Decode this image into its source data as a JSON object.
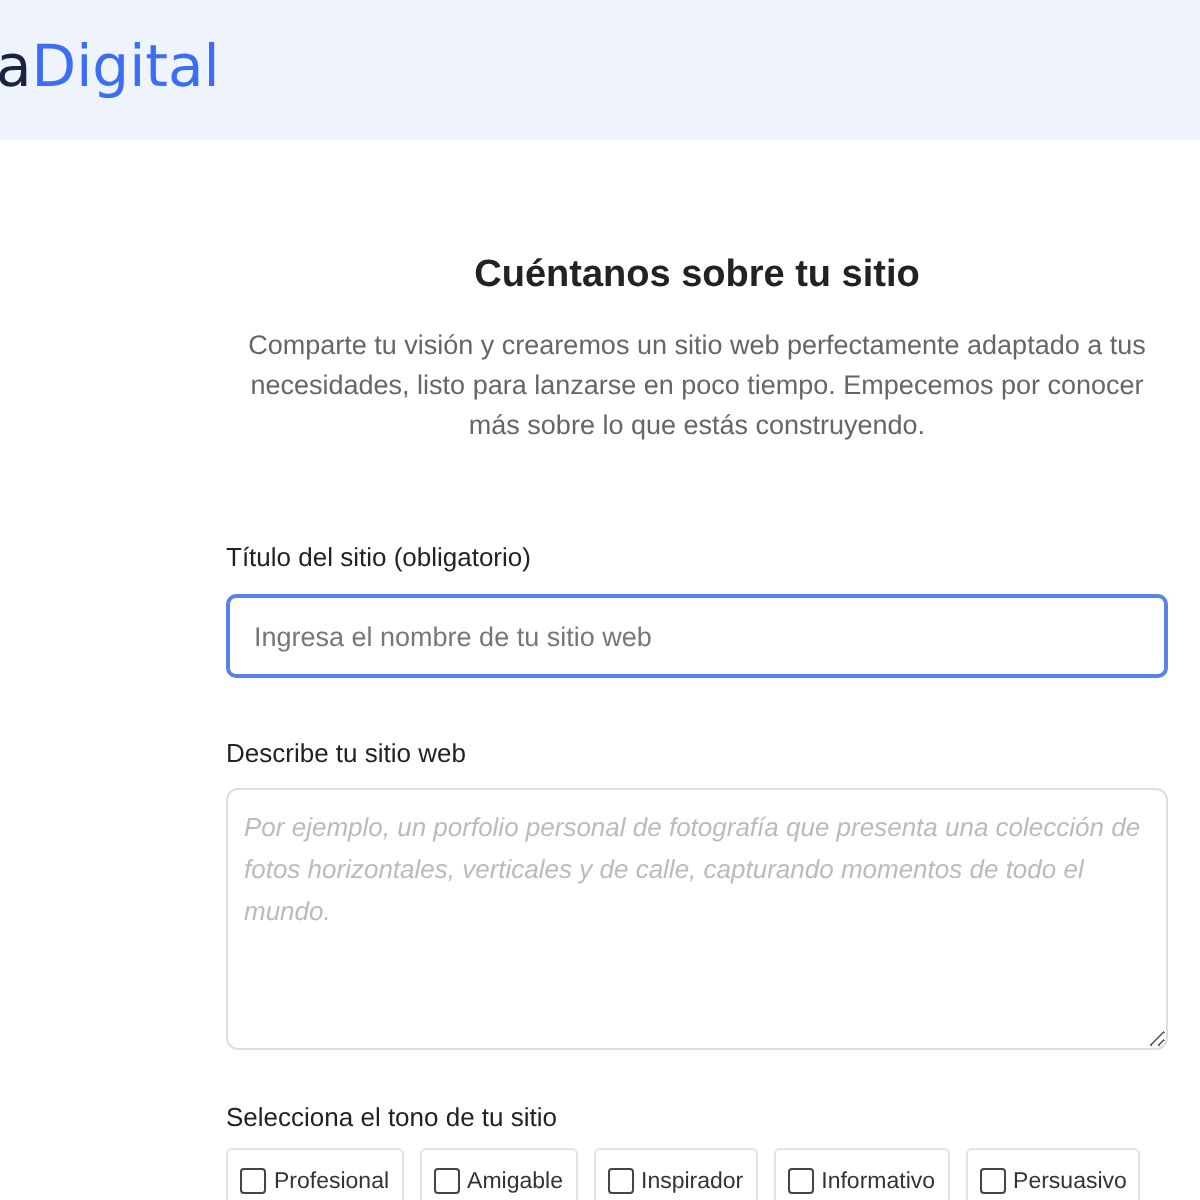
{
  "header": {
    "logo": {
      "prefix": "a",
      "accent": "Digital"
    }
  },
  "heading": "Cuéntanos sobre tu sitio",
  "intro": "Comparte tu visión y crearemos un sitio web perfectamente adaptado a tus necesidades, listo para lanzarse en poco tiempo. Empecemos por conocer más sobre lo que estás construyendo.",
  "title_field": {
    "label": "Título del sitio (obligatorio)",
    "placeholder": "Ingresa el nombre de tu sitio web",
    "focused": true
  },
  "description_field": {
    "label": "Describe tu sitio web",
    "placeholder": "Por ejemplo, un porfolio personal de fotografía que presenta una colección de fotos horizontales, verticales y de calle, capturando momentos de todo el mundo."
  },
  "tone": {
    "label": "Selecciona el tono de tu sitio",
    "options": [
      {
        "label": "Profesional",
        "checked": false
      },
      {
        "label": "Amigable",
        "checked": false
      },
      {
        "label": "Inspirador",
        "checked": false
      },
      {
        "label": "Informativo",
        "checked": false
      },
      {
        "label": "Persuasivo",
        "checked": false
      }
    ]
  }
}
